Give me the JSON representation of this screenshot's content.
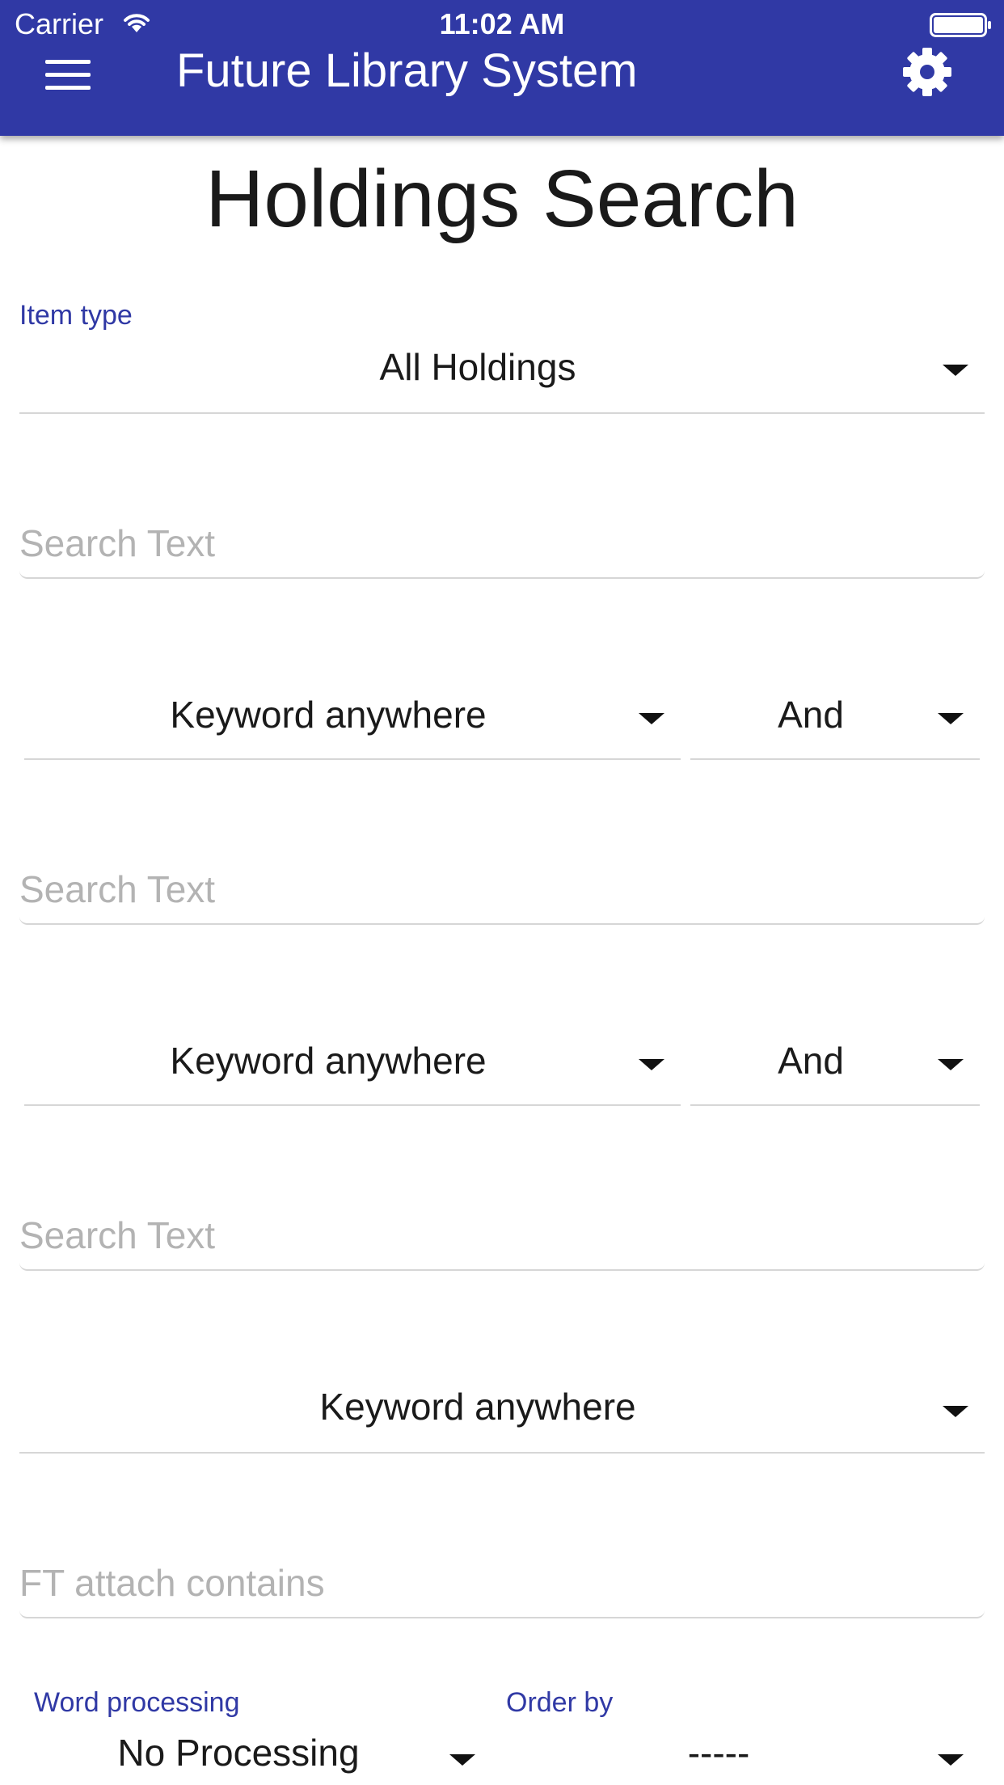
{
  "status_bar": {
    "carrier": "Carrier",
    "time": "11:02 AM"
  },
  "header": {
    "title": "Future Library System",
    "menu_icon": "hamburger-menu-icon",
    "settings_icon": "gear-icon",
    "background_color": "#3039a5"
  },
  "page": {
    "title": "Holdings Search"
  },
  "form": {
    "item_type": {
      "label": "Item type",
      "value": "All Holdings"
    },
    "search_rows": [
      {
        "placeholder": "Search Text",
        "field": "Keyword anywhere",
        "operator": "And"
      },
      {
        "placeholder": "Search Text",
        "field": "Keyword anywhere",
        "operator": "And"
      },
      {
        "placeholder": "Search Text",
        "field": "Keyword anywhere"
      }
    ],
    "ft_attach": {
      "placeholder": "FT attach contains"
    },
    "word_processing": {
      "label": "Word processing",
      "value": "No Processing"
    },
    "order_by": {
      "label": "Order by",
      "value": "-----"
    }
  },
  "colors": {
    "accent": "#3039a5",
    "underline": "#d6d6d6",
    "placeholder": "#b3b3b3",
    "text": "#1a1a1a"
  }
}
